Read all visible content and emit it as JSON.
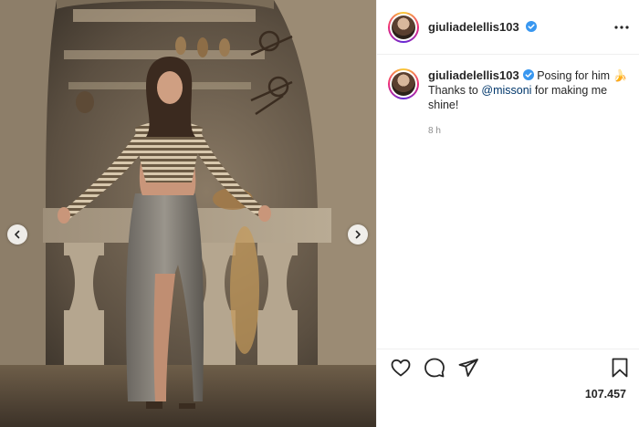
{
  "post": {
    "author": {
      "username": "giuliadelellis103",
      "verified": true
    },
    "caption": {
      "text_before_mention": "Posing for him",
      "emoji": "🍌",
      "thanks_prefix": "Thanks to ",
      "mention": "@missoni",
      "text_after_mention": " for making me shine!"
    },
    "timestamp": "8 h",
    "likes_count": "107.457",
    "media": {
      "carousel_prev_icon": "chevron-left-icon",
      "carousel_next_icon": "chevron-right-icon"
    }
  },
  "icons": {
    "more": "more-horizontal-icon",
    "like": "heart-icon",
    "comment": "comment-icon",
    "share": "paper-plane-icon",
    "save": "bookmark-icon",
    "verified": "verified-badge-icon"
  },
  "colors": {
    "accent_blue": "#3897f0",
    "mention": "#00376b",
    "muted": "#8e8e8e",
    "text": "#262626"
  }
}
